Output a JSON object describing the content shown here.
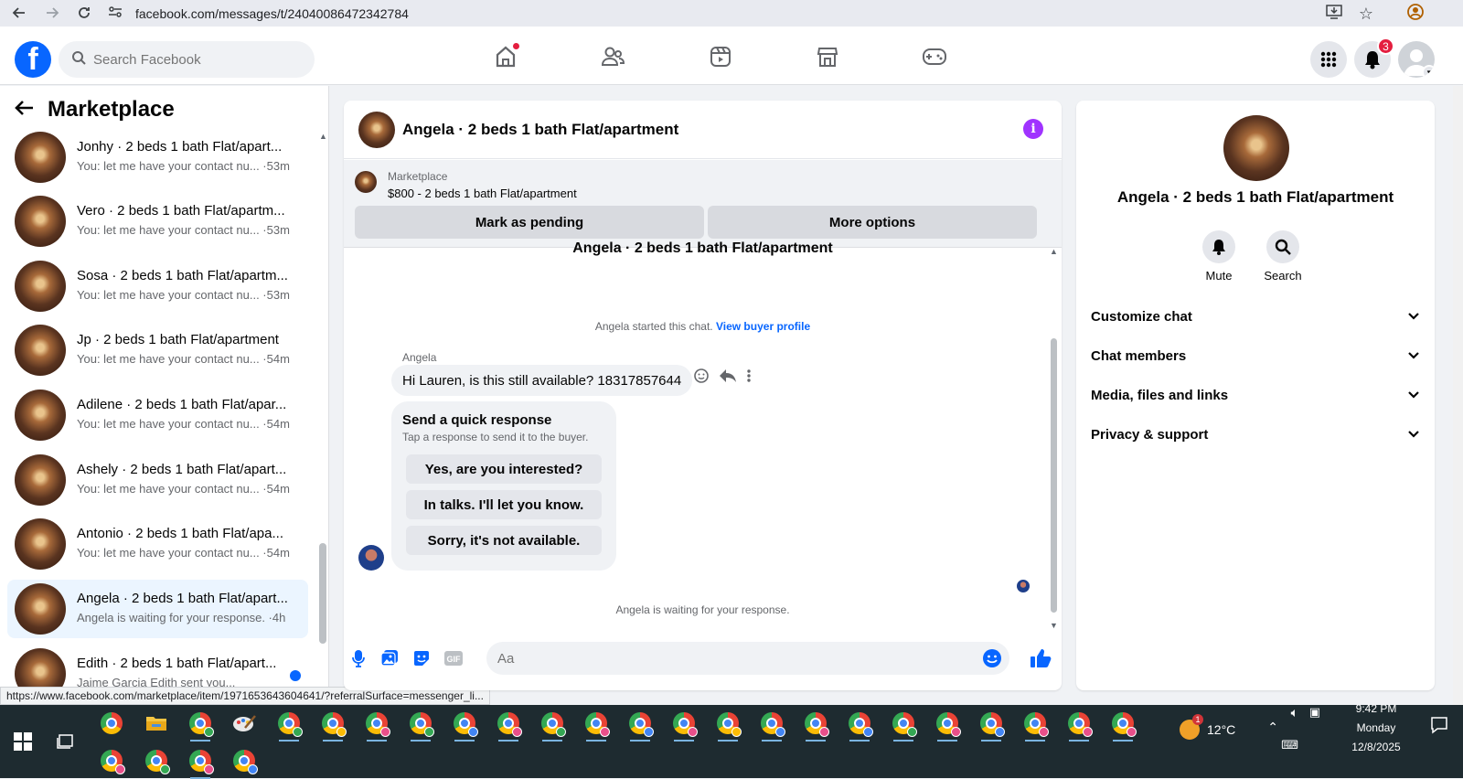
{
  "browser": {
    "url": "facebook.com/messages/t/24040086472342784"
  },
  "header": {
    "search_placeholder": "Search Facebook",
    "notification_count": "3"
  },
  "left_panel": {
    "title": "Marketplace",
    "conversations": [
      {
        "name": "Jonhy · 2 beds 1 bath Flat/apart...",
        "preview": "You: let me have your contact nu... ·53m"
      },
      {
        "name": "Vero · 2 beds 1 bath Flat/apartm...",
        "preview": "You: let me have your contact nu... ·53m"
      },
      {
        "name": "Sosa · 2 beds 1 bath Flat/apartm...",
        "preview": "You: let me have your contact nu... ·53m"
      },
      {
        "name": "Jp · 2 beds 1 bath Flat/apartment",
        "preview": "You: let me have your contact nu... ·54m"
      },
      {
        "name": "Adilene · 2 beds 1 bath Flat/apar...",
        "preview": "You: let me have your contact nu... ·54m"
      },
      {
        "name": "Ashely · 2 beds 1 bath Flat/apart...",
        "preview": "You: let me have your contact nu... ·54m"
      },
      {
        "name": "Antonio · 2 beds 1 bath Flat/apa...",
        "preview": "You: let me have your contact nu... ·54m"
      },
      {
        "name": "Angela · 2 beds 1 bath Flat/apart...",
        "preview": "Angela is waiting for your response. ·4h"
      },
      {
        "name": "Edith · 2 beds 1 bath Flat/apart...",
        "preview": "Jaime Garcia Edith sent you..."
      }
    ],
    "status_url": "https://www.facebook.com/marketplace/item/1971653643604641/?referralSurface=messenger_li..."
  },
  "chat": {
    "title": "Angela · 2 beds 1 bath Flat/apartment",
    "marketplace_label": "Marketplace",
    "listing": "$800 - 2 beds 1 bath Flat/apartment",
    "mark_pending": "Mark as pending",
    "more_options": "More options",
    "cutoff_title": "Angela · 2 beds 1 bath Flat/apartment",
    "started_note": "Angela started this chat.",
    "view_buyer_profile": "View buyer profile",
    "sender": "Angela",
    "message": "Hi Lauren, is this still available? 18317857644",
    "quick_title": "Send a quick response",
    "quick_sub": "Tap a response to send it to the buyer.",
    "quick_replies": [
      "Yes, are you interested?",
      "In talks. I'll let you know.",
      "Sorry, it's not available."
    ],
    "waiting_note": "Angela is waiting for your response.",
    "input_placeholder": "Aa"
  },
  "right_panel": {
    "name": "Angela · 2 beds 1 bath Flat/apartment",
    "mute": "Mute",
    "search": "Search",
    "sections": [
      "Customize chat",
      "Chat members",
      "Media, files and links",
      "Privacy & support"
    ]
  },
  "taskbar": {
    "temperature": "12°C",
    "weather_badge": "1",
    "time": "9:42 PM",
    "day": "Monday",
    "date": "12/8/2025"
  },
  "colors": {
    "fb_blue": "#0866ff",
    "active_convo": "#ebf5ff",
    "info_purple": "#a033ff"
  }
}
